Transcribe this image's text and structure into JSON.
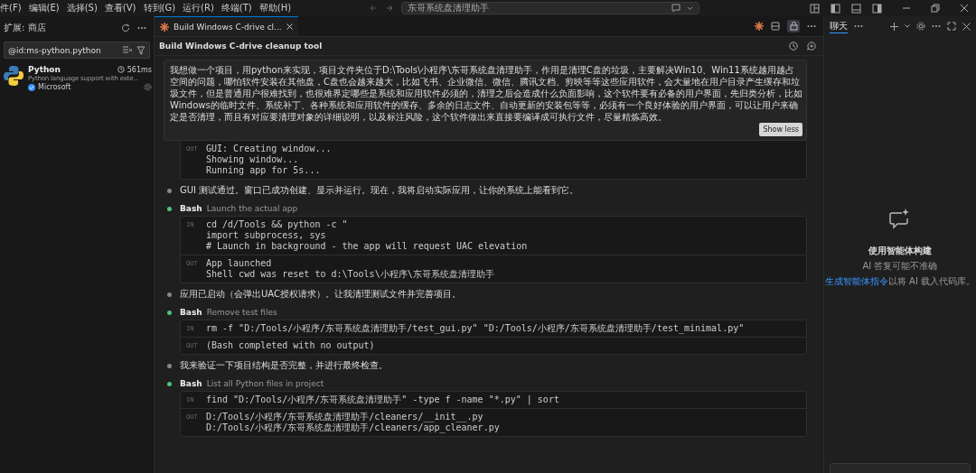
{
  "menu": [
    "件(F)",
    "编辑(E)",
    "选择(S)",
    "查看(V)",
    "转到(G)",
    "运行(R)",
    "终端(T)",
    "帮助(H)"
  ],
  "search": {
    "value": "东哥系统盘清理助手"
  },
  "sidebar": {
    "title": "扩展: 商店",
    "search": {
      "value": "@id:ms-python.python"
    },
    "extension": {
      "name": "Python",
      "time": "561ms",
      "description": "Python language support with exte...",
      "publisher": "Microsoft",
      "verified": true
    }
  },
  "editor": {
    "tab": {
      "title": "Build Windows C-drive cl...",
      "selected": true
    },
    "header": "Build Windows C-drive cleanup tool",
    "prompt": {
      "text": "我想做一个项目，用python来实现，项目文件夹位于D:\\Tools\\小程序\\东哥系统盘清理助手，作用是清理C盘的垃圾，主要解决Win10、Win11系统越用越占空间的问题，哪怕软件安装在其他盘，C盘也会越来越大，比如飞书、企业微信、微信、腾讯文档、剪映等等这些应用软件，会大量地在用户目录产生缓存和垃圾文件，但是普通用户很难找到，也很难界定哪些是系统和应用软件必须的，清理之后会造成什么负面影响，这个软件要有必备的用户界面，先归类分析，比如Windows的临时文件、系统补丁、各种系统和应用软件的缓存、多余的日志文件、自动更新的安装包等等，必须有一个良好体验的用户界面，可以让用户来确定是否清理，而且有对应要清理对象的详细说明，以及标注风险，这个软件做出来直接要编译成可执行文件，尽量精炼高效。",
      "button": "Show less"
    },
    "timeline": [
      {
        "kind": "output",
        "sections": [
          {
            "label": "OUT",
            "lines": [
              "GUI: Creating window...",
              "Showing window...",
              "Running app for 5s..."
            ]
          }
        ]
      },
      {
        "kind": "message",
        "text": "GUI 测试通过。窗口已成功创建、显示并运行。现在，我将启动实际应用，让你的系统上能看到它。"
      },
      {
        "kind": "tool",
        "tool": "Bash",
        "title": "Launch the actual app",
        "sections": [
          {
            "label": "IN",
            "lines": [
              "cd /d/Tools && python -c \"",
              "import subprocess, sys",
              "# Launch in background - the app will request UAC elevation"
            ]
          },
          {
            "label": "OUT",
            "lines": [
              "App launched",
              "Shell cwd was reset to d:\\Tools\\小程序\\东哥系统盘清理助手"
            ]
          }
        ]
      },
      {
        "kind": "message",
        "text": "应用已启动（会弹出UAC授权请求）。让我清理测试文件并完善项目。"
      },
      {
        "kind": "tool",
        "tool": "Bash",
        "title": "Remove test files",
        "sections": [
          {
            "label": "IN",
            "lines": [
              "rm -f \"D:/Tools/小程序/东哥系统盘清理助手/test_gui.py\" \"D:/Tools/小程序/东哥系统盘清理助手/test_minimal.py\""
            ]
          },
          {
            "label": "OUT",
            "lines": [
              "(Bash completed with no output)"
            ]
          }
        ]
      },
      {
        "kind": "message",
        "text": "我来验证一下项目结构是否完整，并进行最终检查。"
      },
      {
        "kind": "tool",
        "tool": "Bash",
        "title": "List all Python files in project",
        "sections": [
          {
            "label": "IN",
            "lines": [
              "find \"D:/Tools/小程序/东哥系统盘清理助手\" -type f -name \"*.py\" | sort"
            ]
          },
          {
            "label": "OUT",
            "lines": [
              "D:/Tools/小程序/东哥系统盘清理助手/cleaners/__init__.py",
              "D:/Tools/小程序/东哥系统盘清理助手/cleaners/app_cleaner.py"
            ]
          }
        ]
      }
    ]
  },
  "chat": {
    "tab": {
      "label": "聊天",
      "selected": true
    },
    "title": "使用智能体构建",
    "subtitle": "AI 答复可能不准确",
    "link": "生成智能体指令",
    "link_suffix": "以将 AI 载入代码库。"
  }
}
